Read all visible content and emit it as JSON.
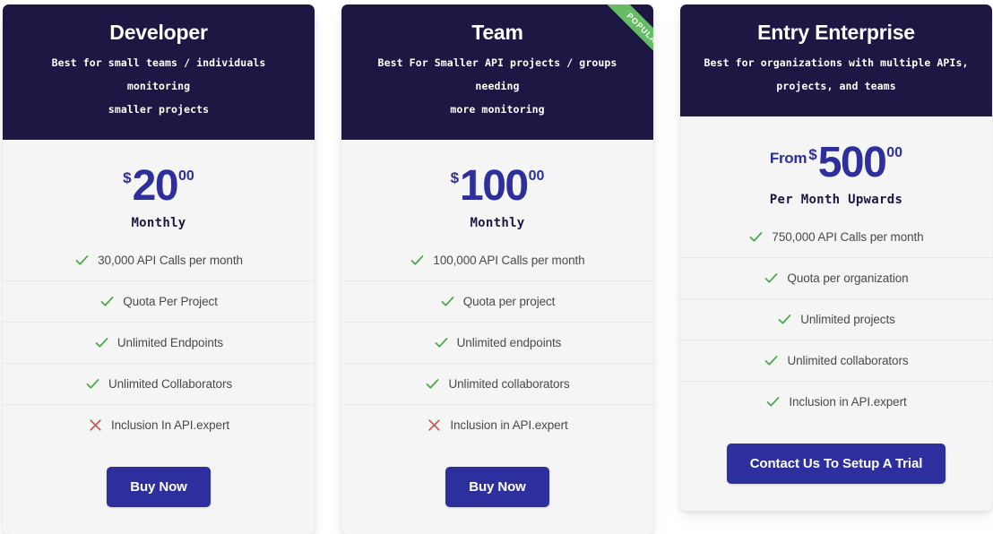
{
  "theme": {
    "header_bg": "#1c1743",
    "card_bg": "#f5f5f6",
    "price_color": "#2c2f9c",
    "cta_bg": "#2e2f9e",
    "check_color": "#46a846",
    "cross_color": "#d94b4b",
    "ribbon_bg": "#65bd63"
  },
  "plans": [
    {
      "name": "Developer",
      "tagline_line1": "Best for small teams / individuals monitoring",
      "tagline_line2": "smaller projects",
      "ribbon": null,
      "price": {
        "prefix": "",
        "currency": "$",
        "amount": "20",
        "cents": "00",
        "period": "Monthly"
      },
      "features": [
        {
          "icon": "check-icon",
          "included": true,
          "label": "30,000 API Calls per month"
        },
        {
          "icon": "check-icon",
          "included": true,
          "label": "Quota Per Project"
        },
        {
          "icon": "check-icon",
          "included": true,
          "label": "Unlimited Endpoints"
        },
        {
          "icon": "check-icon",
          "included": true,
          "label": "Unlimited Collaborators"
        },
        {
          "icon": "cross-icon",
          "included": false,
          "label": "Inclusion In API.expert"
        }
      ],
      "cta_label": "Buy Now"
    },
    {
      "name": "Team",
      "tagline_line1": "Best For Smaller API projects / groups needing",
      "tagline_line2": "more monitoring",
      "ribbon": "POPULAR",
      "price": {
        "prefix": "",
        "currency": "$",
        "amount": "100",
        "cents": "00",
        "period": "Monthly"
      },
      "features": [
        {
          "icon": "check-icon",
          "included": true,
          "label": "100,000 API Calls per month"
        },
        {
          "icon": "check-icon",
          "included": true,
          "label": "Quota per project"
        },
        {
          "icon": "check-icon",
          "included": true,
          "label": "Unlimited endpoints"
        },
        {
          "icon": "check-icon",
          "included": true,
          "label": "Unlimited collaborators"
        },
        {
          "icon": "cross-icon",
          "included": false,
          "label": "Inclusion in API.expert"
        }
      ],
      "cta_label": "Buy Now"
    },
    {
      "name": "Entry Enterprise",
      "tagline_line1": "Best for organizations with multiple APIs,",
      "tagline_line2": "projects, and teams",
      "ribbon": null,
      "price": {
        "prefix": "From",
        "currency": "$",
        "amount": "500",
        "cents": "00",
        "period": "Per Month Upwards"
      },
      "features": [
        {
          "icon": "check-icon",
          "included": true,
          "label": "750,000 API Calls per month"
        },
        {
          "icon": "check-icon",
          "included": true,
          "label": "Quota per organization"
        },
        {
          "icon": "check-icon",
          "included": true,
          "label": "Unlimited projects"
        },
        {
          "icon": "check-icon",
          "included": true,
          "label": "Unlimited collaborators"
        },
        {
          "icon": "check-icon",
          "included": true,
          "label": "Inclusion in API.expert"
        }
      ],
      "cta_label": "Contact Us To Setup A Trial"
    }
  ]
}
